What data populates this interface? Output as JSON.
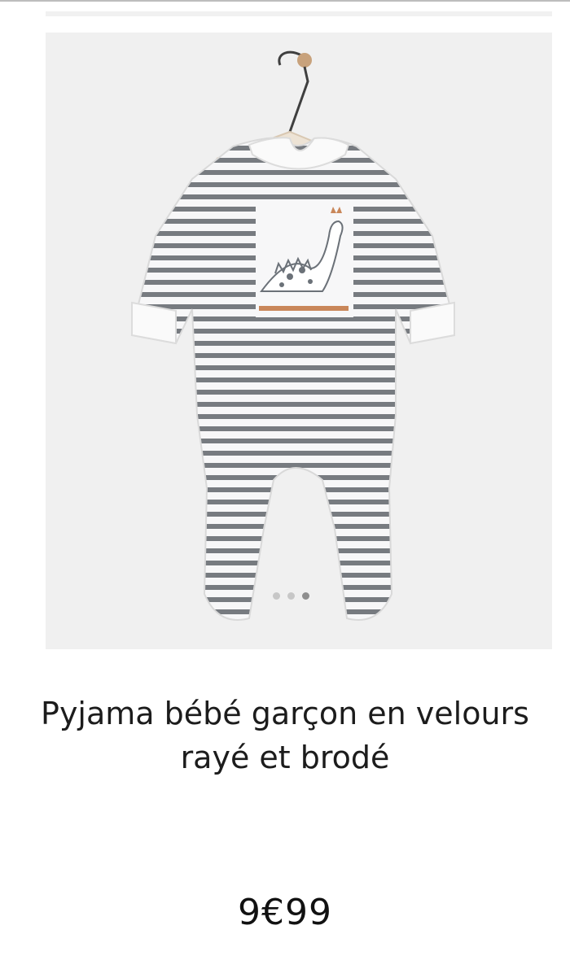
{
  "product": {
    "image_alt": "Pyjama rayé gris et blanc avec dinosaure brodé",
    "title": "Pyjama bébé garçon en velours rayé et brodé",
    "price": "9€99",
    "colors": {
      "stripe": "#777b80",
      "fabric": "#f7f7f8",
      "embroidery_accent": "#c9875a",
      "background": "#f0f0f0"
    },
    "carousel": {
      "total_images": 3,
      "active_index": 2
    }
  }
}
